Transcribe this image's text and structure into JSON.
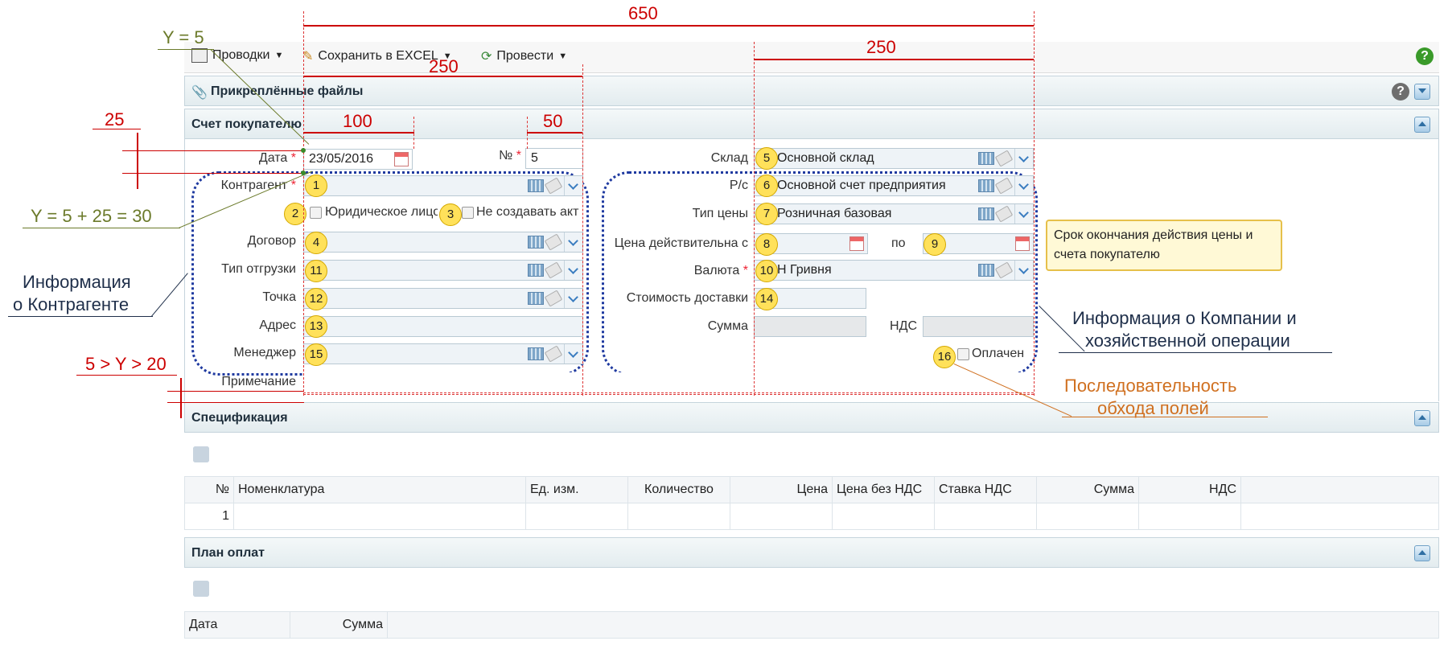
{
  "toolbar": {
    "postings": "Проводки",
    "save_excel": "Сохранить в EXCEL",
    "post": "Провести"
  },
  "attached_files": "Прикреплённые файлы",
  "invoice_panel": "Счет покупателю",
  "form": {
    "date_label": "Дата",
    "date_value": "23/05/2016",
    "number_label": "№",
    "number_value": "5",
    "counterparty_label": "Контрагент",
    "legal_entity_label": "Юридическое лицо",
    "no_act_label": "Не создавать акт",
    "contract_label": "Договор",
    "shipment_type_label": "Тип отгрузки",
    "point_label": "Точка",
    "address_label": "Адрес",
    "manager_label": "Менеджер",
    "note_label": "Примечание",
    "warehouse_label": "Склад",
    "warehouse_value": "Основной склад",
    "account_label": "Р/с",
    "account_value": "Основной счет предприятия",
    "price_type_label": "Тип цены",
    "price_type_value": "Розничная базовая",
    "price_valid_label": "Цена действительна с",
    "to_label": "по",
    "currency_label": "Валюта",
    "currency_value": "Н Гривня",
    "delivery_label": "Стоимость доставки",
    "sum_label": "Сумма",
    "vat_label": "НДС",
    "paid_label": "Оплачен"
  },
  "badges": [
    "1",
    "2",
    "3",
    "4",
    "5",
    "6",
    "7",
    "8",
    "9",
    "10",
    "11",
    "12",
    "13",
    "14",
    "15",
    "16"
  ],
  "spec_panel": "Спецификация",
  "spec_table": {
    "headers": [
      "№",
      "Номенклатура",
      "Ед. изм.",
      "Количество",
      "Цена",
      "Цена без НДС",
      "Ставка НДС",
      "Сумма",
      "НДС"
    ],
    "rows": [
      [
        "1",
        "",
        "",
        "",
        "",
        "",
        "",
        "",
        ""
      ]
    ]
  },
  "pay_panel": "План оплат",
  "pay_table": {
    "headers": [
      "Дата",
      "Сумма"
    ]
  },
  "annotations": {
    "w650": "650",
    "w250_top": "250",
    "w250_mid": "250",
    "w100": "100",
    "w50": "50",
    "h25": "25",
    "y5": "Y = 5",
    "y30": "Y = 5 + 25 = 30",
    "y_range": "5 > Y > 20",
    "counterparty_info_1": "Информация",
    "counterparty_info_2": "о Контрагенте",
    "company_info_1": "Информация о Компании и",
    "company_info_2": "хозяйственной операции",
    "sequence_1": "Последовательность",
    "sequence_2": "обхода полей",
    "tooltip_1": "Срок окончания действия цены и",
    "tooltip_2": "счета покупателю"
  },
  "colors": {
    "annotation_red": "#cc0000",
    "annotation_green": "#6b7a2a",
    "annotation_orange": "#d07020",
    "annotation_navy": "#1f3a8a"
  }
}
